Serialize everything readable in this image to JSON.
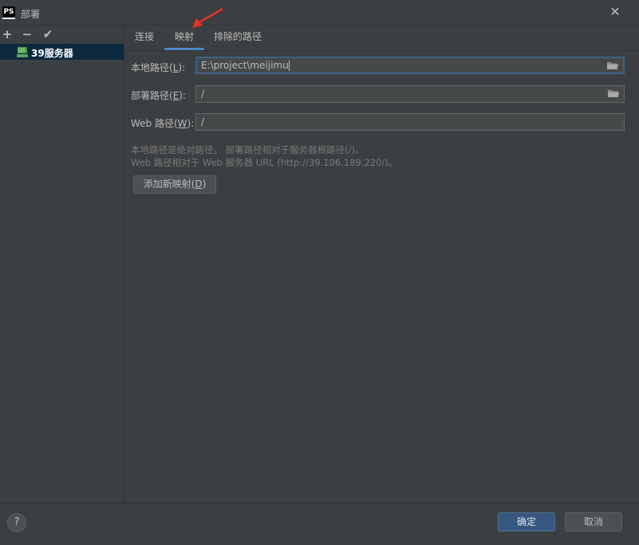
{
  "window": {
    "app_icon_text": "PS",
    "title": "部署",
    "close_glyph": "✕"
  },
  "toolbar": {
    "add_glyph": "+",
    "remove_glyph": "−",
    "check_glyph": "✔"
  },
  "servers": [
    {
      "label": "39服务器",
      "icon": "ftp-icon"
    }
  ],
  "tabs": [
    {
      "label": "连接"
    },
    {
      "label": "映射",
      "active": true
    },
    {
      "label": "排除的路径"
    }
  ],
  "form": {
    "local_path": {
      "label_pre": "本地路径(",
      "mnemonic": "L",
      "label_post": "):",
      "value": "E:\\project\\meijimu"
    },
    "deploy_path": {
      "label_pre": "部署路径(",
      "mnemonic": "E",
      "label_post": "):",
      "value": "/"
    },
    "web_path": {
      "label_pre": "Web 路径(",
      "mnemonic": "W",
      "label_post": "):",
      "value": "/"
    }
  },
  "hints": {
    "line1": "本地路径是绝对路径。 部署路径相对于服务器根路径(/)。",
    "line2": "Web 路径相对于 Web 服务器 URL (http://39.106.189.220/)。"
  },
  "add_mapping": {
    "label_pre": "添加新映射(",
    "mnemonic": "D",
    "label_post": ")"
  },
  "footer": {
    "help_glyph": "?",
    "ok_label": "确定",
    "cancel_label": "取消"
  },
  "colors": {
    "background": "#3c3f41",
    "selection": "#0d293e",
    "accent": "#4a88c7",
    "primary_button": "#365880",
    "annotation_arrow": "#e8302a"
  }
}
